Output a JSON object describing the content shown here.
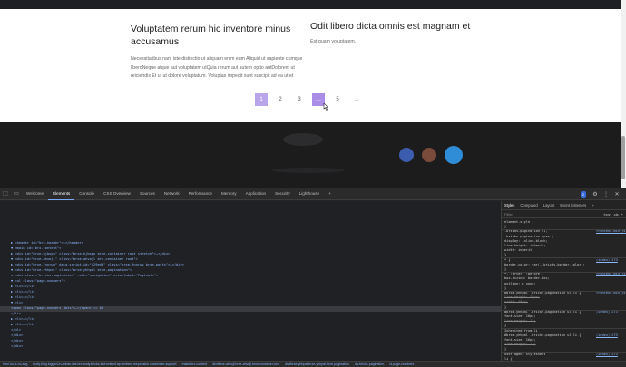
{
  "posts": [
    {
      "title": "Voluptatem rerum hic inventore minus accusamus",
      "excerpt": "Necessitatibus nam iste distinctio ut aliquam enim eum Aliquid ut sapiente cumque liberoNeque atque aut voluptatem utQuia rerum aut autem optio autDolorem ut reiciendis Et ut ut dolore voluptatum. Voluptas impedit sunt suscipit ad ea ut et"
    },
    {
      "title": "Odit libero dicta omnis est magnam et",
      "excerpt": "Est quam voluptatem."
    }
  ],
  "pagination": {
    "items": [
      "1",
      "2",
      "3",
      "…",
      "5",
      "→"
    ],
    "current": "1"
  },
  "devtools": {
    "tabs": [
      "Welcome",
      "Elements",
      "Console",
      "CSS Overview",
      "Sources",
      "Network",
      "Performance",
      "Memory",
      "Application",
      "Security",
      "Lighthouse",
      "+"
    ],
    "issues_badge": "2",
    "styles_tabs": [
      "Styles",
      "Computed",
      "Layout",
      "Event Listeners",
      "»"
    ],
    "filter_placeholder": "Filter",
    "filter_hov": ":hov",
    "filter_cls": ".cls",
    "dom_lines": [
      "▶ <header id=\"brx-header\">…</header>",
      "▼ <main id=\"brx-content\">",
      "  ▶ <div id=\"brxe-hjbxpo\" class=\"brxe-hjbxpo brxe-container root stretch\">…</div>",
      "  ▼ <div id=\"brxe-ahvojl\" class=\"brxe-ahvojl brx-container root\">",
      "    ▶ <div id=\"brxe-fnnrwg\" data-script-id=\"u29ed0\" class=\"brxe-fnnrwg brxe-posts\">…</div>",
      "    ▼ <div id=\"brxe-yhhpal\" class=\"brxe-yhhpal brxe-pagination\">",
      "      ▼ <div class=\"bricks-pagination\" role=\"navigation\" aria-label=\"Paginate\">",
      "        ▼ <ul class=\"page-numbers\">",
      "          ▶ <li>…</li>",
      "          ▶ <li>…</li>",
      "          ▶ <li>…</li>",
      "          ▼ <li>",
      "              <span class=\"page-numbers dots\">…</span> == $0",
      "            </li>",
      "          ▶ <li>…</li>",
      "          ▶ <li>…</li>",
      "          </ul>",
      "        </div>",
      "      </div>",
      "    </div>"
    ],
    "style_rules": [
      "element.style {",
      "}",
      ".bricks-pagination ul,",
      "  .bricks-pagination span {",
      "  display: inline-block;",
      "  line-height: inherit;",
      "  width: inherit;",
      "}",
      "* {",
      "  border-color: var(--bricks-border-color);",
      "}",
      "*, :after, :before {",
      "  box-sizing: border-box;",
      "  outline: ▶ none;",
      "}",
      "#brxe-yhhpal .bricks-pagination ul li {",
      "  line-height: 48px;",
      "  width: 48px;",
      "}",
      "#brxe-yhhpal .bricks-pagination ul li {",
      "  font-size: 16px;",
      "  line-height: 17;",
      "}",
      "Inherited from li",
      "#brxe-yhhpal .bricks-pagination ul li {",
      "  font-size: 16px;",
      "  line-height: 17;",
      "}",
      "user agent stylesheet",
      "li {",
      "  text-align: -webkit-match-parent;"
    ],
    "style_links": [
      "frontend.min.js?...:1",
      "(index):273",
      "frontend.min.js?...:1",
      "frontend.min.js?...:1",
      "(index):273",
      "(index):273",
      "(index):273"
    ],
    "breadcrumbs": [
      "html.no-js.no-svg",
      "body.blog.logged-in.admin-bar.brx-body.bricks-is-frontend.wp-embed-responsive.customize-support",
      "main#brx-content",
      "div#brxe-ahvojl.brxe-ahvojl.brxe-container.root",
      "div#brxe-yhhpal.brxe-yhhpal.brxe-pagination",
      "div.bricks-pagination",
      "ul.page-numbers"
    ]
  }
}
